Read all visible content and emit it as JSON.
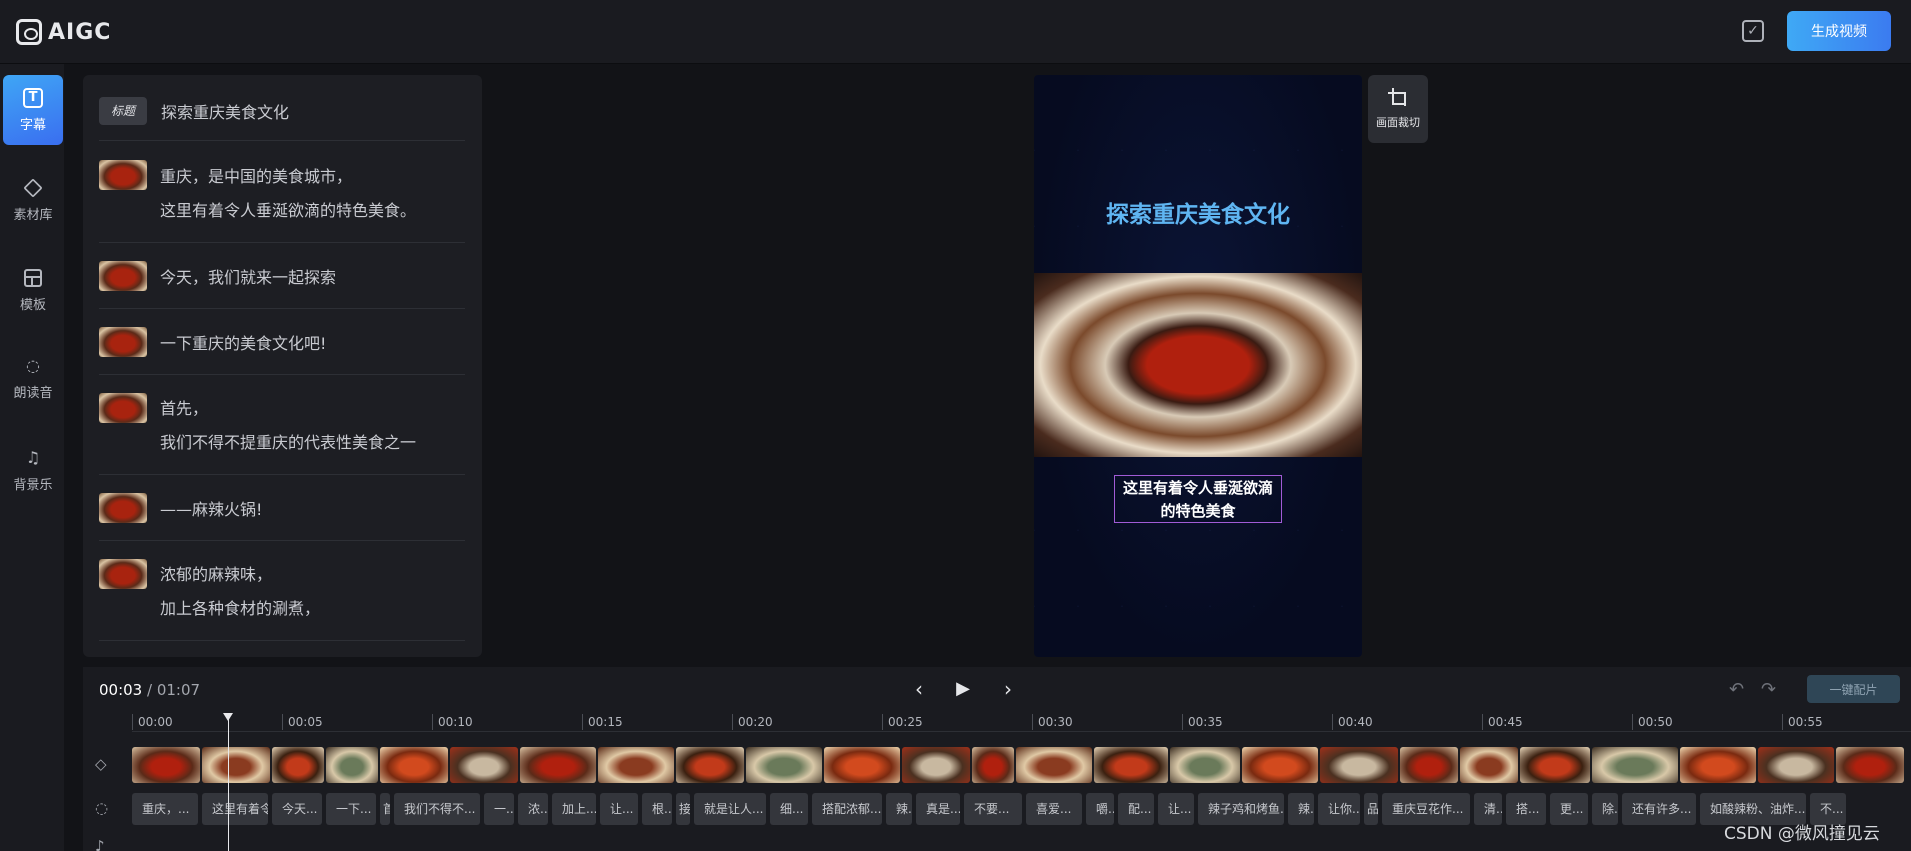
{
  "app": {
    "logo_text": "AIGC",
    "generate_label": "生成视频"
  },
  "rail": [
    {
      "label": "字幕",
      "icon": "subtitle-icon"
    },
    {
      "label": "素材库",
      "icon": "layers-icon"
    },
    {
      "label": "模板",
      "icon": "template-icon"
    },
    {
      "label": "朗读音",
      "icon": "voice-icon"
    },
    {
      "label": "背景乐",
      "icon": "music-icon"
    }
  ],
  "panel": {
    "tag": "标题",
    "title": "探索重庆美食文化",
    "rows": [
      {
        "lines": [
          "重庆，是中国的美食城市，",
          "这里有着令人垂涎欲滴的特色美食。"
        ]
      },
      {
        "lines": [
          "今天，我们就来一起探索"
        ]
      },
      {
        "lines": [
          "一下重庆的美食文化吧!"
        ]
      },
      {
        "lines": [
          "首先，",
          "我们不得不提重庆的代表性美食之一"
        ]
      },
      {
        "lines": [
          "——麻辣火锅!"
        ]
      },
      {
        "lines": [
          "浓郁的麻辣味，",
          "加上各种食材的涮煮，"
        ]
      }
    ]
  },
  "preview": {
    "title": "探索重庆美食文化",
    "caption_line1": "这里有着令人垂涎欲滴",
    "caption_line2": "的特色美食"
  },
  "crop": {
    "label": "画面裁切"
  },
  "timeline": {
    "current": "00:03",
    "separator": " / ",
    "total": "01:07",
    "auto_label": "一键配片",
    "ticks": [
      "00:00",
      "00:05",
      "00:10",
      "00:15",
      "00:20",
      "00:25",
      "00:30",
      "00:35",
      "00:40",
      "00:45",
      "00:50",
      "00:55"
    ],
    "subtitle_clips": [
      "重庆，...",
      "这里有着令...",
      "今天...",
      "一下...",
      "首",
      "我们不得不...",
      "一...",
      "浓...",
      "加上...",
      "让...",
      "根...",
      "接",
      "就是让人...",
      "细...",
      "搭配浓郁...",
      "辣...",
      "真是...",
      "不要...",
      "喜爱...",
      "嚼...",
      "配...",
      "让...",
      "辣子鸡和烤鱼...",
      "辣...",
      "让你...",
      "品",
      "重庆豆花作...",
      "清...",
      "搭...",
      "更...",
      "除...",
      "还有许多...",
      "如酸辣粉、油炸...",
      "不..."
    ]
  },
  "watermark": "CSDN @微风撞见云"
}
